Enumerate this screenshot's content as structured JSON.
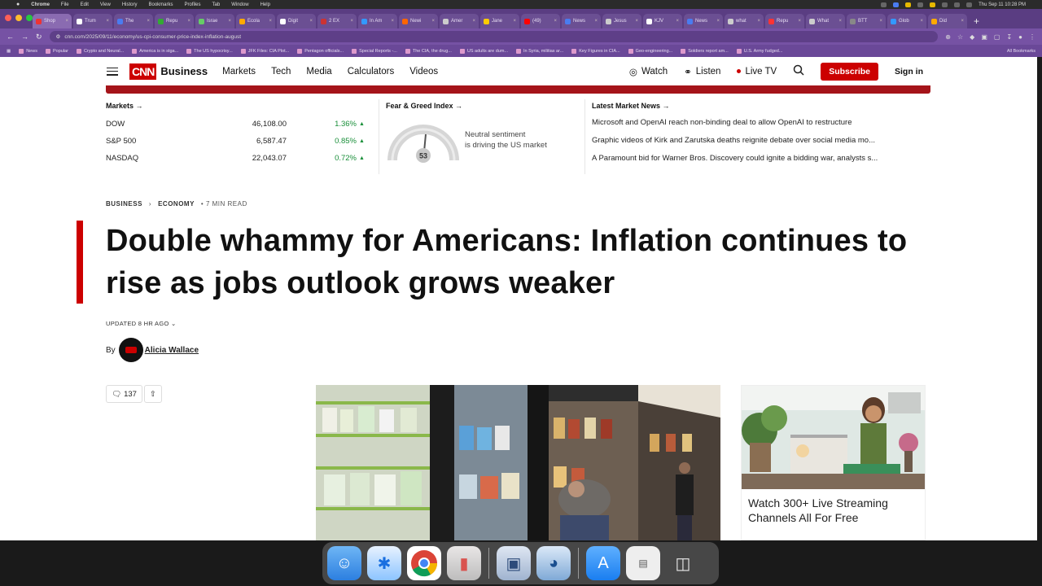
{
  "menubar": {
    "app": "Chrome",
    "items": [
      "File",
      "Edit",
      "View",
      "History",
      "Bookmarks",
      "Profiles",
      "Tab",
      "Window",
      "Help"
    ],
    "clock": "Thu Sep 11  10:28 PM"
  },
  "tabs": [
    "Shop",
    "Trum",
    "The",
    "Repu",
    "Israe",
    "Ecola",
    "Digit",
    "2 EX",
    "In Am",
    "Newi",
    "Amer",
    "Jane",
    "(49)",
    "News",
    "Jesus",
    "KJV",
    "News",
    "what",
    "Repu",
    "What",
    "BTT",
    "Glob",
    "Did"
  ],
  "url": "cnn.com/2025/09/11/economy/us-cpi-consumer-price-index-inflation-august",
  "bookmarks": [
    "News",
    "Popular",
    "Crypto and Neural...",
    "America is in stga...",
    "The US hypocrisy...",
    "JFK Files: CIA Plot...",
    "Pentagon officials...",
    "Special Reports -...",
    "The CIA, the drug...",
    "US adults are dum...",
    "In Syria, militias ar...",
    "Key Figures in CIA...",
    "Geo-engineering...",
    "Soldiers report am...",
    "U.S. Army fudged..."
  ],
  "bookmarks_all": "All Bookmarks",
  "nav": {
    "logo": "CNN",
    "brand": "Business",
    "links": [
      "Markets",
      "Tech",
      "Media",
      "Calculators",
      "Videos"
    ],
    "watch": "Watch",
    "listen": "Listen",
    "live_tv": "Live TV",
    "subscribe": "Subscribe",
    "sign_in": "Sign in"
  },
  "markets": {
    "heading": "Markets →",
    "rows": [
      {
        "name": "DOW",
        "value": "46,108.00",
        "change": "1.36%"
      },
      {
        "name": "S&P 500",
        "value": "6,587.47",
        "change": "0.85%"
      },
      {
        "name": "NASDAQ",
        "value": "22,043.07",
        "change": "0.72%"
      }
    ]
  },
  "fear_greed": {
    "heading": "Fear & Greed Index →",
    "value": "53",
    "line1": "Neutral sentiment",
    "line2": "is driving the US market"
  },
  "latest_news": {
    "heading": "Latest Market News →",
    "items": [
      "Microsoft and OpenAI reach non-binding deal to allow OpenAI to restructure",
      "Graphic videos of Kirk and Zarutska deaths reignite debate over social media mo...",
      "A Paramount bid for Warner Bros. Discovery could ignite a bidding war, analysts s..."
    ]
  },
  "article": {
    "crumb1": "BUSINESS",
    "crumb2": "ECONOMY",
    "read_time": "• 7 MIN READ",
    "headline": "Double whammy for Americans: Inflation continues to rise as jobs outlook grows weaker",
    "updated": "UPDATED 8 HR AGO",
    "by": "By",
    "author": "Alicia Wallace",
    "comments": "137"
  },
  "ad": {
    "caption": "Watch 300+ Live Streaming Channels All For Free"
  },
  "colors": {
    "cnn_red": "#cc0000",
    "positive_green": "#1a8f3a",
    "chrome_purple": "#7652a4"
  }
}
